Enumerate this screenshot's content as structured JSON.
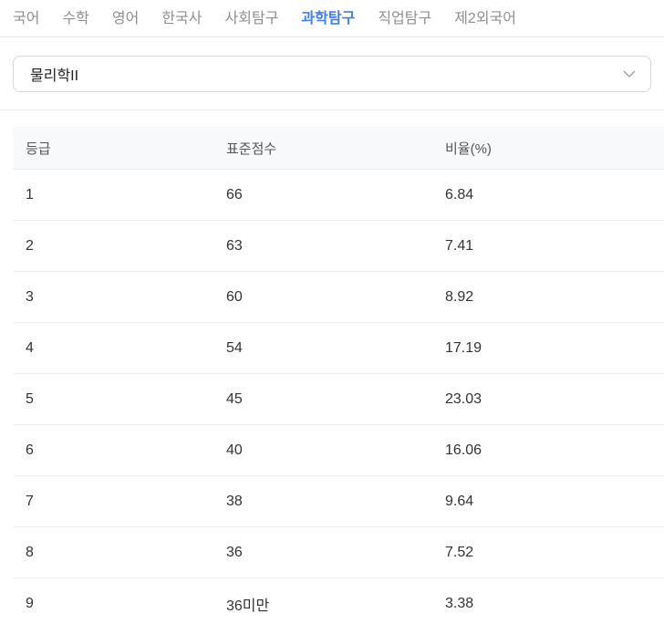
{
  "tab_bar": {
    "items": [
      {
        "label": "국어",
        "active": false
      },
      {
        "label": "수학",
        "active": false
      },
      {
        "label": "영어",
        "active": false
      },
      {
        "label": "한국사",
        "active": false
      },
      {
        "label": "사회탐구",
        "active": false
      },
      {
        "label": "과학탐구",
        "active": true
      },
      {
        "label": "직업탐구",
        "active": false
      },
      {
        "label": "제2외국어",
        "active": false
      }
    ]
  },
  "subject_dropdown": {
    "selected_value": "물리학II",
    "icon": "chevron-down-icon"
  },
  "grade_table": {
    "columns": [
      "등급",
      "표준점수",
      "비율(%)"
    ],
    "rows": [
      [
        "1",
        "66",
        "6.84"
      ],
      [
        "2",
        "63",
        "7.41"
      ],
      [
        "3",
        "60",
        "8.92"
      ],
      [
        "4",
        "54",
        "17.19"
      ],
      [
        "5",
        "45",
        "23.03"
      ],
      [
        "6",
        "40",
        "16.06"
      ],
      [
        "7",
        "38",
        "9.64"
      ],
      [
        "8",
        "36",
        "7.52"
      ],
      [
        "9",
        "36미만",
        "3.38"
      ]
    ]
  },
  "colors": {
    "active_tab": "#3f7df6",
    "inactive_tab": "#8f8f8f",
    "table_header_bg": "#f8f9fa",
    "row_border": "#f0f0f0",
    "dropdown_border": "#d9d9d9"
  }
}
